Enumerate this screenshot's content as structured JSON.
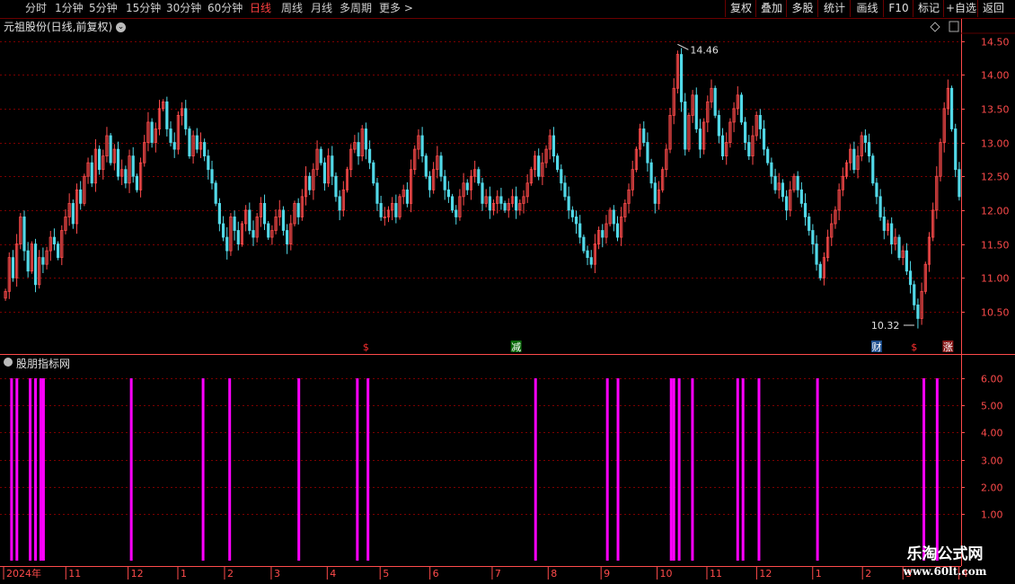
{
  "toolbar": {
    "periods": [
      "分时",
      "1分钟",
      "5分钟",
      "15分钟",
      "30分钟",
      "60分钟",
      "日线",
      "周线",
      "月线",
      "多周期",
      "更多 >"
    ],
    "active_period": "日线",
    "right_buttons": [
      "复权",
      "叠加",
      "多股",
      "统计",
      "画线",
      "F10",
      "标记",
      "+自选",
      "返回"
    ]
  },
  "main_title": "元祖股份(日线,前复权)",
  "sub_title": "股朋指标网",
  "watermark": {
    "title": "乐淘公式网",
    "url": "www.60lt.com"
  },
  "colors": {
    "up": "#ff4b4b",
    "down": "#52d9e8",
    "indicator": "#ff00ff",
    "grid": "#7a0000",
    "axis": "#ff4b4b"
  },
  "chart_data": [
    {
      "type": "candlestick",
      "y_ticks": [
        "14.50",
        "14.00",
        "13.50",
        "13.00",
        "12.50",
        "12.00",
        "11.50",
        "11.00",
        "10.50"
      ],
      "ylim": [
        10.3,
        14.6
      ],
      "annotations": {
        "high_label": "14.46",
        "low_label": "10.32"
      },
      "markers": [
        {
          "label": "$",
          "index": 96,
          "kind": "dividend"
        },
        {
          "label": "减",
          "index": 136,
          "kind": "reduce"
        },
        {
          "label": "财",
          "index": 232,
          "kind": "report"
        },
        {
          "label": "$",
          "index": 242,
          "kind": "dividend"
        },
        {
          "label": "涨",
          "index": 251,
          "kind": "rise"
        }
      ],
      "closes": [
        10.8,
        11.3,
        11.0,
        11.5,
        11.9,
        11.4,
        11.1,
        11.5,
        10.9,
        11.3,
        11.2,
        11.4,
        11.6,
        11.5,
        11.3,
        11.7,
        11.9,
        12.1,
        11.8,
        12.3,
        12.1,
        12.5,
        12.7,
        12.4,
        12.9,
        12.6,
        12.8,
        13.1,
        12.7,
        12.9,
        12.5,
        12.6,
        12.4,
        12.8,
        12.5,
        12.3,
        12.7,
        13.0,
        13.3,
        13.0,
        13.2,
        13.5,
        13.6,
        13.2,
        13.0,
        12.9,
        13.4,
        13.5,
        13.2,
        12.8,
        13.1,
        12.9,
        13.0,
        12.8,
        12.6,
        12.4,
        12.1,
        11.8,
        11.6,
        11.4,
        11.9,
        11.7,
        11.5,
        11.8,
        12.0,
        11.7,
        11.6,
        11.9,
        12.1,
        11.8,
        11.6,
        11.7,
        11.9,
        12.0,
        11.7,
        11.5,
        11.8,
        12.1,
        11.9,
        12.2,
        12.5,
        12.3,
        12.6,
        12.9,
        12.7,
        12.4,
        12.8,
        12.5,
        12.2,
        12.0,
        12.3,
        12.6,
        12.9,
        13.0,
        12.8,
        13.2,
        12.9,
        12.7,
        12.4,
        12.1,
        11.9,
        11.9,
        12.0,
        12.1,
        11.9,
        12.2,
        12.3,
        12.1,
        12.6,
        12.9,
        13.1,
        12.8,
        12.5,
        12.3,
        12.6,
        12.8,
        12.5,
        12.3,
        12.2,
        12.0,
        11.9,
        12.2,
        12.4,
        12.3,
        12.5,
        12.6,
        12.4,
        12.1,
        12.2,
        12.0,
        12.1,
        12.2,
        12.1,
        12.0,
        12.1,
        12.2,
        12.0,
        12.1,
        12.2,
        12.4,
        12.6,
        12.8,
        12.5,
        12.7,
        12.9,
        13.1,
        12.8,
        12.6,
        12.4,
        12.2,
        12.0,
        11.9,
        11.8,
        11.6,
        11.4,
        11.3,
        11.2,
        11.5,
        11.7,
        11.6,
        11.8,
        12.0,
        11.8,
        11.6,
        11.9,
        12.1,
        12.3,
        12.6,
        12.9,
        13.2,
        13.0,
        12.7,
        12.4,
        12.1,
        12.3,
        12.6,
        12.9,
        13.4,
        13.8,
        14.3,
        13.6,
        12.9,
        13.4,
        13.7,
        13.2,
        12.9,
        13.3,
        13.6,
        13.8,
        13.4,
        13.1,
        12.8,
        13.0,
        13.3,
        13.5,
        13.7,
        13.3,
        13.0,
        12.8,
        13.1,
        13.4,
        13.2,
        12.9,
        12.7,
        12.5,
        12.3,
        12.4,
        12.2,
        12.0,
        12.3,
        12.5,
        12.3,
        12.1,
        11.9,
        11.7,
        11.5,
        11.2,
        11.0,
        11.3,
        11.6,
        11.8,
        12.0,
        12.3,
        12.5,
        12.7,
        12.9,
        12.6,
        12.8,
        13.1,
        13.0,
        12.8,
        12.4,
        12.2,
        11.9,
        11.7,
        11.8,
        11.5,
        11.6,
        11.3,
        11.4,
        11.1,
        10.9,
        10.6,
        10.4,
        10.8,
        11.2,
        11.6,
        12.0,
        12.5,
        13.0,
        13.5,
        13.8,
        13.2,
        12.6,
        12.2
      ]
    },
    {
      "type": "bar",
      "y_ticks": [
        "6.00",
        "5.00",
        "4.00",
        "3.00",
        "2.00",
        "1.00"
      ],
      "ylim": [
        0.4,
        6.3
      ],
      "signal_value": 6,
      "signal_indices": [
        3,
        5,
        10,
        12,
        14,
        15,
        48,
        75,
        85,
        111,
        133,
        137,
        200,
        227,
        231,
        251,
        252,
        254,
        259,
        276,
        278,
        284,
        306,
        346,
        351
      ]
    }
  ],
  "x_axis": {
    "labels": [
      "2024年",
      "11",
      "12",
      "1",
      "2",
      "3",
      "4",
      "5",
      "6",
      "7",
      "8",
      "9",
      "10",
      "11",
      "12",
      "1",
      "2",
      "3",
      "4"
    ],
    "positions_index": [
      0,
      20,
      40,
      56,
      71,
      86,
      104,
      121,
      137,
      157,
      175,
      192,
      210,
      226,
      242,
      260,
      276,
      289,
      307
    ]
  }
}
